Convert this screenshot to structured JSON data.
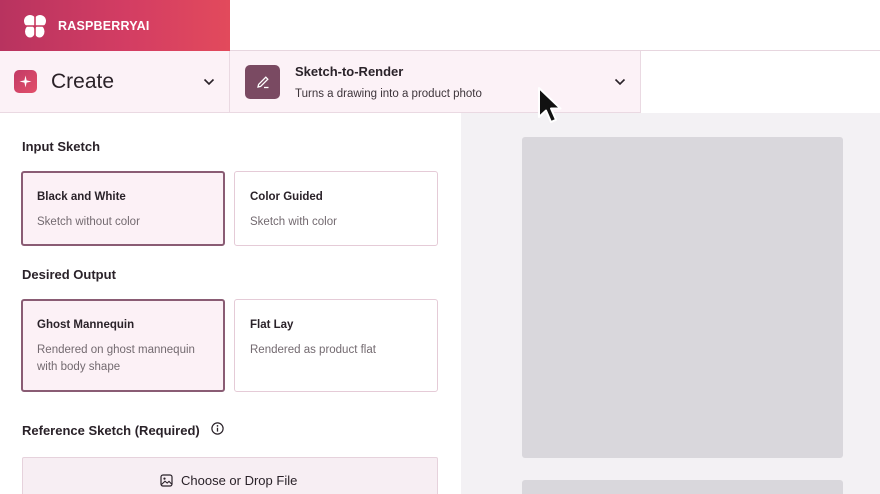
{
  "brand": {
    "name": "RASPBERRYAI",
    "logo_icon": "raspberry-logo-icon",
    "gradient": [
      "#b8335f",
      "#e24a5c"
    ]
  },
  "mode_select": {
    "label": "Create",
    "icon": "sparkle-icon"
  },
  "tool_select": {
    "title": "Sketch-to-Render",
    "description": "Turns a drawing into a product photo",
    "icon": "pencil-icon"
  },
  "input_sketch": {
    "title": "Input Sketch",
    "options": [
      {
        "title": "Black and White",
        "description": "Sketch without color",
        "selected": true
      },
      {
        "title": "Color Guided",
        "description": "Sketch with color",
        "selected": false
      }
    ]
  },
  "desired_output": {
    "title": "Desired Output",
    "options": [
      {
        "title": "Ghost Mannequin",
        "description": "Rendered on ghost mannequin with body shape",
        "selected": true
      },
      {
        "title": "Flat Lay",
        "description": "Rendered as product flat",
        "selected": false
      }
    ]
  },
  "reference_sketch": {
    "title": "Reference Sketch (Required)",
    "info_icon": "info-icon",
    "upload_label": "Choose or Drop File",
    "upload_icon": "image-icon"
  },
  "colors": {
    "accent": "#c23a66",
    "selected_border": "#8a5c74",
    "panel_tint": "#fcf2f7"
  }
}
